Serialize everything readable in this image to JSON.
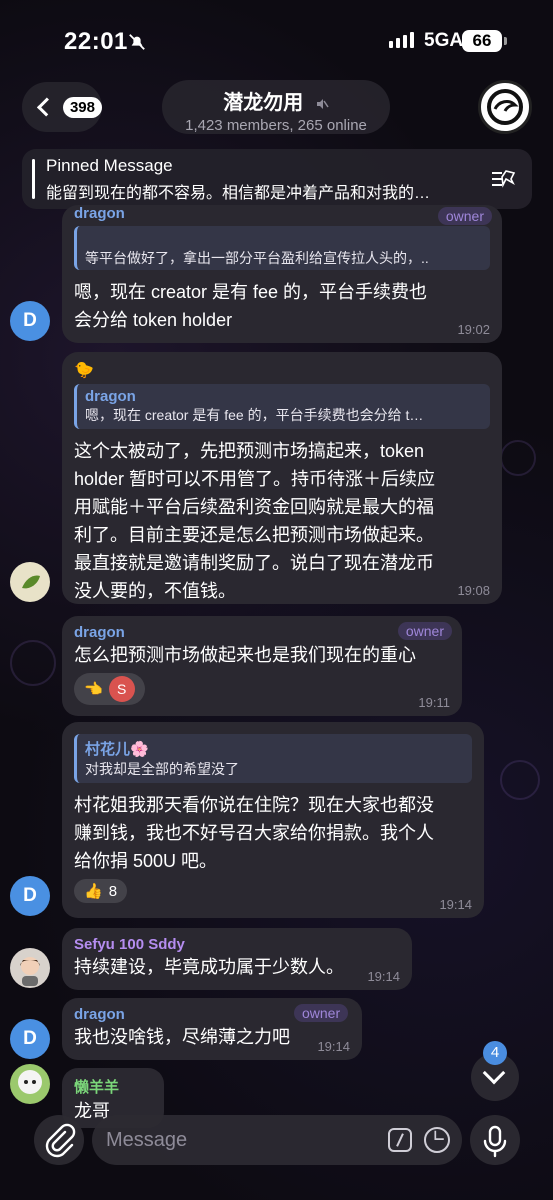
{
  "status": {
    "time": "22:01",
    "network": "5GA",
    "battery": "66"
  },
  "header": {
    "back_count": "398",
    "title": "潜龙勿用",
    "subtitle": "1,423 members, 265 online"
  },
  "pinned": {
    "title": "Pinned Message",
    "text": "能留到现在的都不容易。相信都是冲着产品和对我的…"
  },
  "messages": [
    {
      "sender": "dragon",
      "role": "owner",
      "quote_text": "等平台做好了，拿出一部分平台盈利给宣传拉人头的，..",
      "text_1": "嗯，现在 creator 是有 fee 的，平台手续费也",
      "text_2": "会分给 token holder",
      "time": "19:02",
      "avatar": "D"
    },
    {
      "quote_name": "dragon",
      "quote_text": "嗯，现在 creator 是有 fee 的，平台手续费也会分给 t…",
      "lines": [
        "这个太被动了，先把预测市场搞起来，token",
        "holder 暂时可以不用管了。持币待涨＋后续应",
        "用赋能＋平台后续盈利资金回购就是最大的福",
        "利了。目前主要还是怎么把预测市场做起来。",
        "最直接就是邀请制奖励了。说白了现在潜龙币",
        "没人要的，不值钱。"
      ],
      "time": "19:08"
    },
    {
      "sender": "dragon",
      "role": "owner",
      "text": "怎么把预测市场做起来也是我们现在的重心",
      "reaction_badge": "S",
      "time": "19:11"
    },
    {
      "quote_name": "村花儿🌸",
      "quote_text": "对我却是全部的希望没了",
      "lines": [
        "村花姐我那天看你说在住院？现在大家也都没",
        "赚到钱，我也不好号召大家给你捐款。我个人",
        "给你捐 500U 吧。"
      ],
      "reaction": "👍",
      "reaction_count": "8",
      "time": "19:14",
      "avatar": "D"
    },
    {
      "sender": "Sefyu 100 Sddy",
      "text": "持续建设，毕竟成功属于少数人。",
      "time": "19:14"
    },
    {
      "sender": "dragon",
      "role": "owner",
      "text": "我也没啥钱，尽绵薄之力吧",
      "time": "19:14",
      "avatar": "D"
    },
    {
      "sender": "懒羊羊",
      "text": "龙哥"
    }
  ],
  "scroll": {
    "unread": "4"
  },
  "input": {
    "placeholder": "Message"
  },
  "colors": {
    "bubble": "#2a2830",
    "name_blue": "#7aa4e6",
    "owner_tag": "#9f86d9",
    "avatar_blue": "#4a90e2"
  }
}
